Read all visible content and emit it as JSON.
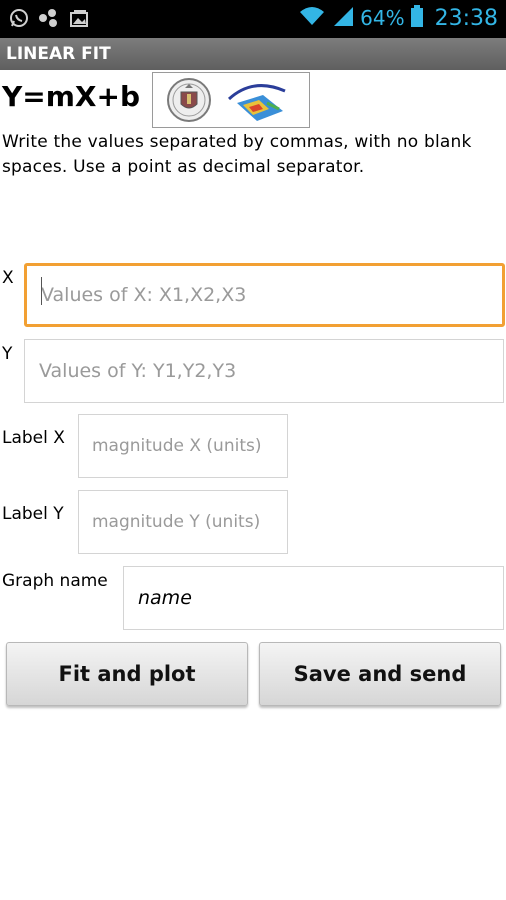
{
  "status_bar": {
    "icons_left": [
      "whatsapp-icon",
      "network-icon",
      "gallery-icon"
    ],
    "icons_right": [
      "wifi-icon",
      "signal-icon",
      "battery-icon"
    ],
    "battery_percent": "64%",
    "time": "23:38"
  },
  "title_bar": {
    "title": "LINEAR FIT"
  },
  "header": {
    "formula": "Y=mX+b",
    "logos": [
      "university-seal",
      "physics-group-logo"
    ]
  },
  "instructions": "Write the values separated by commas, with no blank spaces. Use a point as decimal separator.",
  "form": {
    "x": {
      "label": "X",
      "placeholder": "Values of X: X1,X2,X3",
      "focused": true
    },
    "y": {
      "label": "Y",
      "placeholder": "Values of Y: Y1,Y2,Y3"
    },
    "label_x": {
      "label": "Label X",
      "placeholder": "magnitude X (units)"
    },
    "label_y": {
      "label": "Label Y",
      "placeholder": "magnitude Y (units)"
    },
    "graph_name": {
      "label": "Graph name",
      "value": "name"
    }
  },
  "buttons": {
    "fit": "Fit and plot",
    "save": "Save and send"
  },
  "colors": {
    "accent": "#33b5e5",
    "focus_border": "#f2a033",
    "title_bar": "#6e6e6e"
  }
}
